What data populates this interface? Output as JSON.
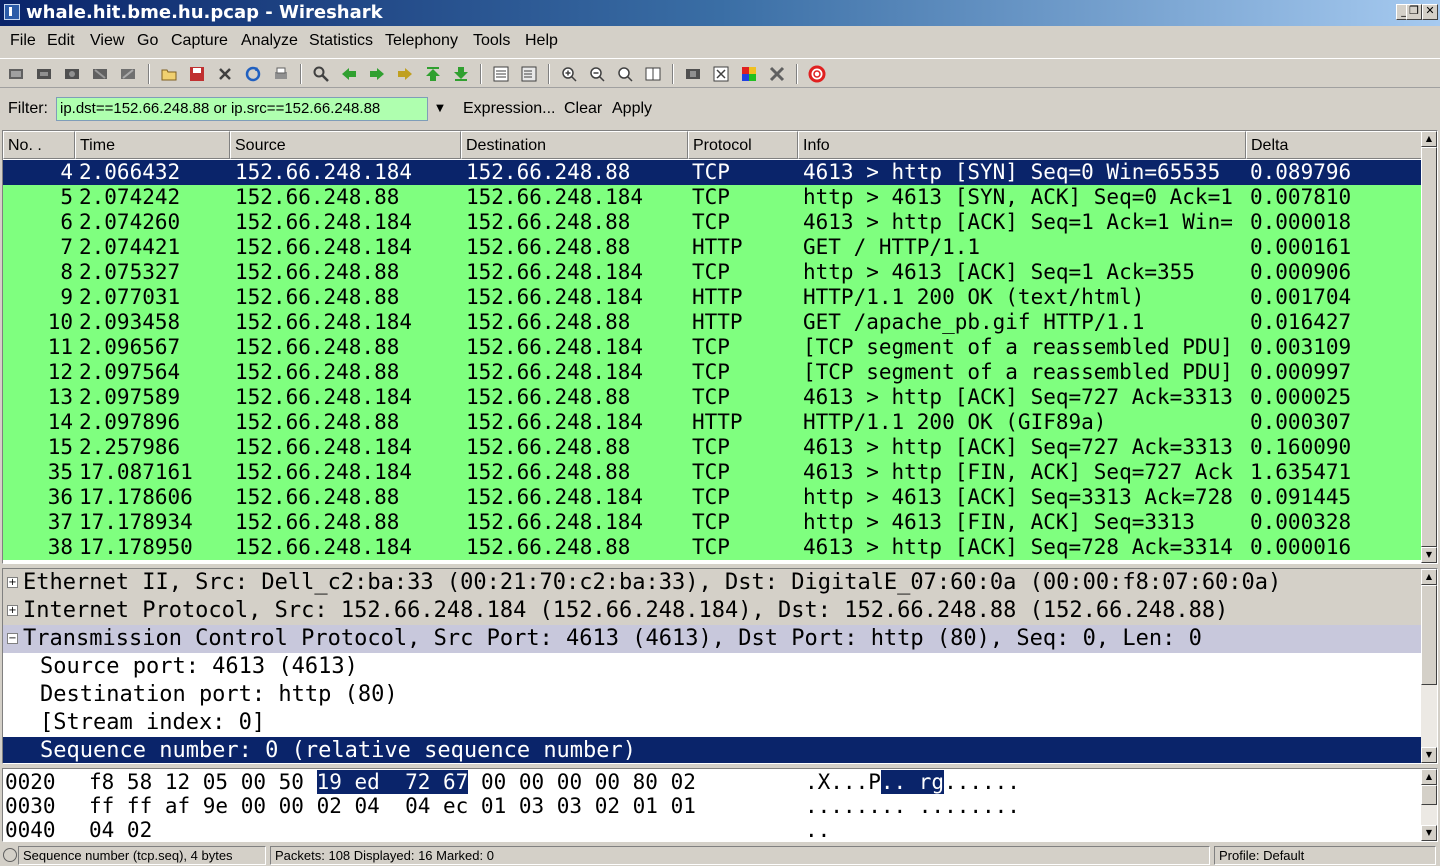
{
  "window": {
    "title": "whale.hit.bme.hu.pcap - Wireshark"
  },
  "menu": [
    "File",
    "Edit",
    "View",
    "Go",
    "Capture",
    "Analyze",
    "Statistics",
    "Telephony",
    "Tools",
    "Help"
  ],
  "filter": {
    "label": "Filter:",
    "value": "ip.dst==152.66.248.88 or ip.src==152.66.248.88",
    "expression_label": "Expression...",
    "clear_label": "Clear",
    "apply_label": "Apply"
  },
  "packet_list": {
    "columns": [
      "No. .",
      "Time",
      "Source",
      "Destination",
      "Protocol",
      "Info",
      "Delta"
    ],
    "rows": [
      {
        "no": "4",
        "time": "2.066432",
        "src": "152.66.248.184",
        "dst": "152.66.248.88",
        "proto": "TCP",
        "info": "4613 > http [SYN] Seq=0 Win=65535",
        "delta": "0.089796",
        "selected": true
      },
      {
        "no": "5",
        "time": "2.074242",
        "src": "152.66.248.88",
        "dst": "152.66.248.184",
        "proto": "TCP",
        "info": "http > 4613 [SYN, ACK] Seq=0 Ack=1",
        "delta": "0.007810"
      },
      {
        "no": "6",
        "time": "2.074260",
        "src": "152.66.248.184",
        "dst": "152.66.248.88",
        "proto": "TCP",
        "info": "4613 > http [ACK] Seq=1 Ack=1 Win=",
        "delta": "0.000018"
      },
      {
        "no": "7",
        "time": "2.074421",
        "src": "152.66.248.184",
        "dst": "152.66.248.88",
        "proto": "HTTP",
        "info": "GET / HTTP/1.1",
        "delta": "0.000161"
      },
      {
        "no": "8",
        "time": "2.075327",
        "src": "152.66.248.88",
        "dst": "152.66.248.184",
        "proto": "TCP",
        "info": "http > 4613 [ACK] Seq=1 Ack=355",
        "delta": "0.000906"
      },
      {
        "no": "9",
        "time": "2.077031",
        "src": "152.66.248.88",
        "dst": "152.66.248.184",
        "proto": "HTTP",
        "info": "HTTP/1.1 200 OK  (text/html)",
        "delta": "0.001704"
      },
      {
        "no": "10",
        "time": "2.093458",
        "src": "152.66.248.184",
        "dst": "152.66.248.88",
        "proto": "HTTP",
        "info": "GET /apache_pb.gif HTTP/1.1",
        "delta": "0.016427"
      },
      {
        "no": "11",
        "time": "2.096567",
        "src": "152.66.248.88",
        "dst": "152.66.248.184",
        "proto": "TCP",
        "info": "[TCP segment of a reassembled PDU]",
        "delta": "0.003109"
      },
      {
        "no": "12",
        "time": "2.097564",
        "src": "152.66.248.88",
        "dst": "152.66.248.184",
        "proto": "TCP",
        "info": "[TCP segment of a reassembled PDU]",
        "delta": "0.000997"
      },
      {
        "no": "13",
        "time": "2.097589",
        "src": "152.66.248.184",
        "dst": "152.66.248.88",
        "proto": "TCP",
        "info": "4613 > http [ACK] Seq=727 Ack=3313",
        "delta": "0.000025"
      },
      {
        "no": "14",
        "time": "2.097896",
        "src": "152.66.248.88",
        "dst": "152.66.248.184",
        "proto": "HTTP",
        "info": "HTTP/1.1 200 OK  (GIF89a)",
        "delta": "0.000307"
      },
      {
        "no": "15",
        "time": "2.257986",
        "src": "152.66.248.184",
        "dst": "152.66.248.88",
        "proto": "TCP",
        "info": "4613 > http [ACK] Seq=727 Ack=3313",
        "delta": "0.160090"
      },
      {
        "no": "35",
        "time": "17.087161",
        "src": "152.66.248.184",
        "dst": "152.66.248.88",
        "proto": "TCP",
        "info": "4613 > http [FIN, ACK] Seq=727 Ack",
        "delta": "1.635471"
      },
      {
        "no": "36",
        "time": "17.178606",
        "src": "152.66.248.88",
        "dst": "152.66.248.184",
        "proto": "TCP",
        "info": "http > 4613 [ACK] Seq=3313 Ack=728",
        "delta": "0.091445"
      },
      {
        "no": "37",
        "time": "17.178934",
        "src": "152.66.248.88",
        "dst": "152.66.248.184",
        "proto": "TCP",
        "info": "http > 4613 [FIN, ACK] Seq=3313",
        "delta": "0.000328"
      },
      {
        "no": "38",
        "time": "17.178950",
        "src": "152.66.248.184",
        "dst": "152.66.248.88",
        "proto": "TCP",
        "info": "4613 > http [ACK] Seq=728 Ack=3314",
        "delta": "0.000016"
      }
    ]
  },
  "details": [
    {
      "text": "Ethernet II, Src: Dell_c2:ba:33 (00:21:70:c2:ba:33), Dst: DigitalE_07:60:0a (00:00:f8:07:60:0a)",
      "expander": "+",
      "style": "hl"
    },
    {
      "text": "Internet Protocol, Src: 152.66.248.184 (152.66.248.184), Dst: 152.66.248.88 (152.66.248.88)",
      "expander": "+",
      "style": "hl"
    },
    {
      "text": "Transmission Control Protocol, Src Port: 4613 (4613), Dst Port: http (80), Seq: 0, Len: 0",
      "expander": "−",
      "style": "hl2"
    },
    {
      "text": "Source port: 4613 (4613)",
      "style": "child"
    },
    {
      "text": "Destination port: http (80)",
      "style": "child"
    },
    {
      "text": "[Stream index: 0]",
      "style": "child"
    },
    {
      "text": "Sequence number: 0    (relative sequence number)",
      "style": "sel"
    }
  ],
  "hex": [
    {
      "offset": "0020",
      "pre": "f8 58 12 05 00 50 ",
      "sel": "19 ed  72 67",
      "post": " 00 00 00 00 80 02",
      "ascii_pre": ".X...P",
      "ascii_sel": ".. rg",
      "ascii_post": "......"
    },
    {
      "offset": "0030",
      "pre": "ff ff af 9e 00 00 02 04  04 ec 01 03 03 02 01 01",
      "sel": "",
      "post": "",
      "ascii_pre": "........ ........",
      "ascii_sel": "",
      "ascii_post": ""
    },
    {
      "offset": "0040",
      "pre": "04 02",
      "sel": "",
      "post": "",
      "ascii_pre": "..",
      "ascii_sel": "",
      "ascii_post": ""
    }
  ],
  "status": {
    "field": "Sequence number (tcp.seq), 4 bytes",
    "packets": "Packets: 108 Displayed: 16 Marked: 0",
    "profile": "Profile: Default"
  },
  "colors": {
    "selected": "#0a246a",
    "row_green": "#7fff7f",
    "filter_ok": "#afffaf"
  }
}
